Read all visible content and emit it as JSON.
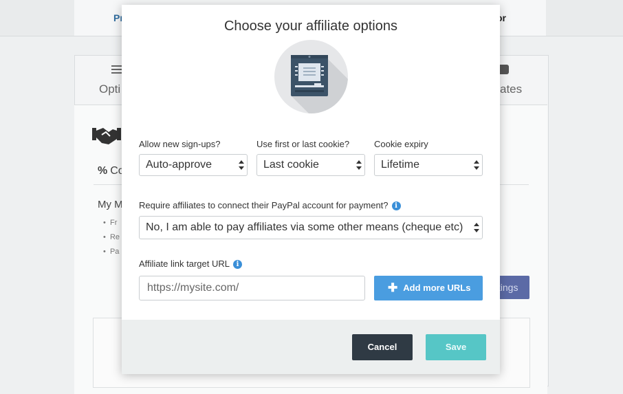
{
  "background": {
    "top_tab_left": "Pr",
    "top_tab_right": "or",
    "options_label": "Opti",
    "affiliates_label": "ates",
    "section_label": "Co",
    "section_icon": "%",
    "my_label": "My M",
    "bullets": [
      "Fr",
      "Re",
      "Pa"
    ],
    "settings_button": "ttings"
  },
  "modal": {
    "title": "Choose your affiliate options",
    "hero_icon": "atm-machine-icon",
    "signups": {
      "label": "Allow new sign-ups?",
      "value": "Auto-approve"
    },
    "cookie": {
      "label": "Use first or last cookie?",
      "value": "Last cookie"
    },
    "expiry": {
      "label": "Cookie expiry",
      "value": "Lifetime"
    },
    "paypal": {
      "label": "Require affiliates to connect their PayPal account for payment?",
      "value": "No, I am able to pay affiliates via some other means (cheque etc)"
    },
    "target_url": {
      "label": "Affiliate link target URL",
      "placeholder": "https://mysite.com/"
    },
    "add_urls_button": "Add more URLs",
    "cancel_button": "Cancel",
    "save_button": "Save"
  },
  "colors": {
    "accent_blue": "#4a9de0",
    "save_teal": "#56c6c6",
    "cancel_dark": "#2f3a44",
    "info_blue": "#3a8fd8"
  }
}
